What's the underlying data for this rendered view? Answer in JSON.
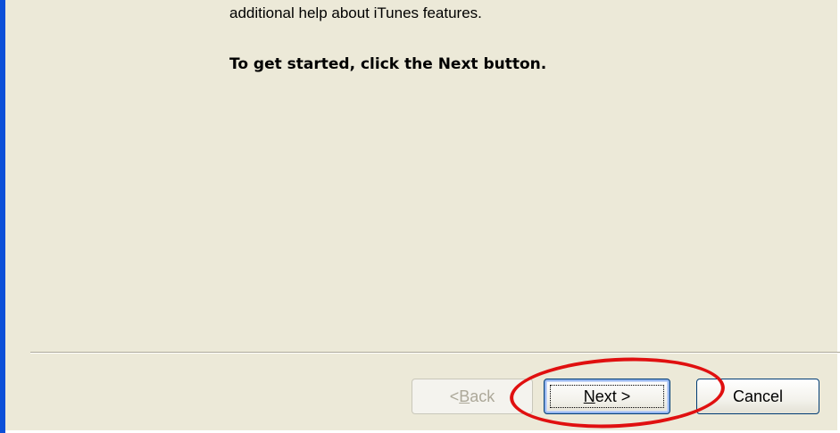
{
  "content": {
    "help_text": "additional help about iTunes features.",
    "start_text": "To get started, click the Next button."
  },
  "buttons": {
    "back": {
      "mnemonic": "B",
      "rest": "ack",
      "prefix": "< ",
      "enabled": false
    },
    "next": {
      "mnemonic": "N",
      "rest": "ext",
      "suffix": " >",
      "enabled": true,
      "focused": true
    },
    "cancel": {
      "label": "Cancel",
      "enabled": true
    }
  },
  "colors": {
    "window_bg": "#ece9d8",
    "left_border": "#0b4fd8",
    "annotation": "#e01010"
  }
}
